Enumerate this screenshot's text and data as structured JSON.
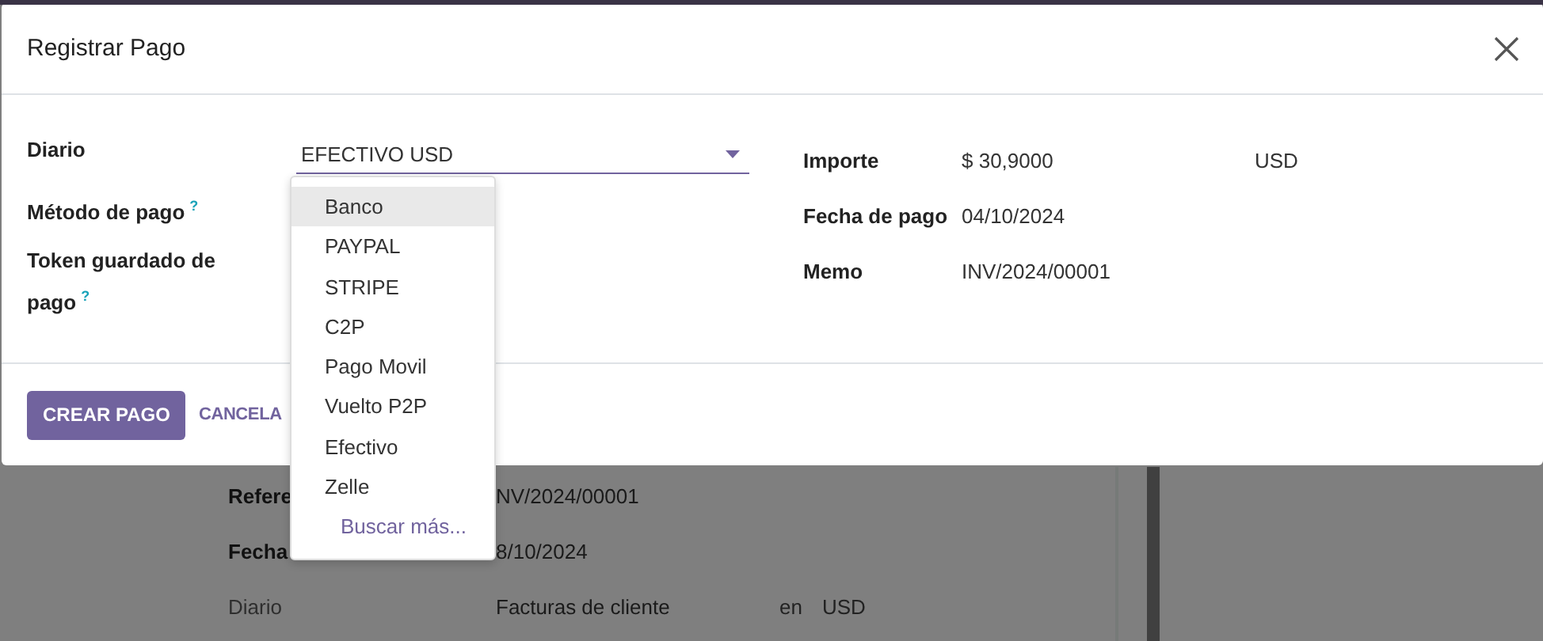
{
  "dialog": {
    "title": "Registrar Pago",
    "fields_left": [
      {
        "label": "Diario",
        "kind": "select",
        "value": "EFECTIVO USD"
      },
      {
        "label": "Método de pago",
        "kind": "empty",
        "help": "?"
      },
      {
        "label": "Token guardado de pago",
        "kind": "empty",
        "help": "?"
      }
    ],
    "fields_right": [
      {
        "label": "Importe",
        "value": "$ 30,9000",
        "currency": "USD"
      },
      {
        "label": "Fecha de pago",
        "value": "04/10/2024"
      },
      {
        "label": "Memo",
        "value": "INV/2024/00001"
      }
    ],
    "buttons": [
      {
        "label": "CREAR PAGO",
        "kind": "primary"
      },
      {
        "label": "CANCELA",
        "kind": "link"
      }
    ]
  },
  "dropdown": {
    "options": [
      {
        "label": "Banco",
        "selected": true
      },
      {
        "label": "PAYPAL",
        "selected": false
      },
      {
        "label": "STRIPE",
        "selected": false
      },
      {
        "label": "C2P",
        "selected": false
      },
      {
        "label": "Pago Movil",
        "selected": false
      },
      {
        "label": "Vuelto P2P",
        "selected": false
      },
      {
        "label": "Efectivo",
        "selected": false
      },
      {
        "label": "Zelle",
        "selected": false
      }
    ],
    "search_more": "Buscar más..."
  },
  "background": {
    "rows": [
      {
        "label": "Refere",
        "emphasized": true,
        "value": "NV/2024/00001"
      },
      {
        "label": "Fecha",
        "emphasized": true,
        "value": "8/10/2024"
      },
      {
        "label": "Diario",
        "emphasized": false,
        "value": "Facturas de cliente",
        "connector": "en",
        "currency": "USD"
      }
    ]
  }
}
